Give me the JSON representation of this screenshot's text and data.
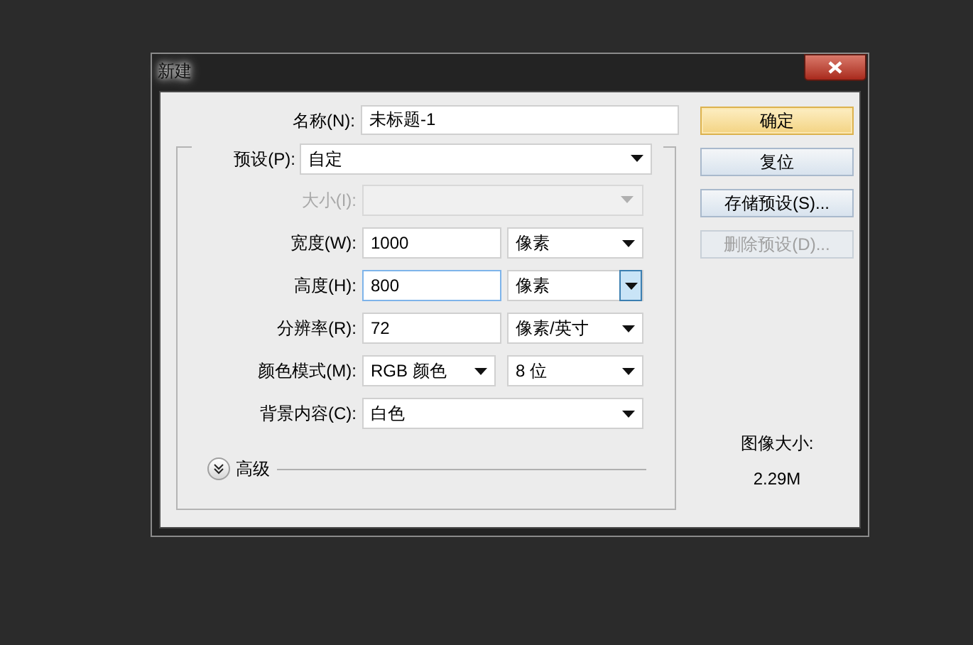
{
  "window": {
    "title": "新建"
  },
  "name": {
    "label": "名称(N):",
    "value": "未标题-1"
  },
  "preset": {
    "label": "预设(P):",
    "value": "自定"
  },
  "rows": [
    {
      "kind": "select",
      "label": "大小(I):",
      "disabled": true
    },
    {
      "kind": "input-unit",
      "label": "宽度(W):",
      "value": "1000",
      "unit": "像素",
      "focused": false
    },
    {
      "kind": "input-unit",
      "label": "高度(H):",
      "value": "800",
      "unit": "像素",
      "focused": true
    },
    {
      "kind": "input-unit",
      "label": "分辨率(R):",
      "value": "72",
      "unit": "像素/英寸",
      "focused": false
    },
    {
      "kind": "select-pair",
      "label": "颜色模式(M):",
      "value": "RGB 颜色",
      "unit": "8 位"
    },
    {
      "kind": "select",
      "label": "背景内容(C):",
      "value": "白色",
      "disabled": false
    }
  ],
  "advanced": {
    "label": "高级",
    "expanded": false
  },
  "buttons": [
    {
      "label": "确定",
      "default": true,
      "disabled": false
    },
    {
      "label": "复位",
      "default": false,
      "disabled": false
    },
    {
      "label": "存储预设(S)...",
      "default": false,
      "disabled": false
    },
    {
      "label": "删除预设(D)...",
      "default": false,
      "disabled": true
    }
  ],
  "image_size": {
    "label": "图像大小:",
    "value": "2.29M"
  }
}
